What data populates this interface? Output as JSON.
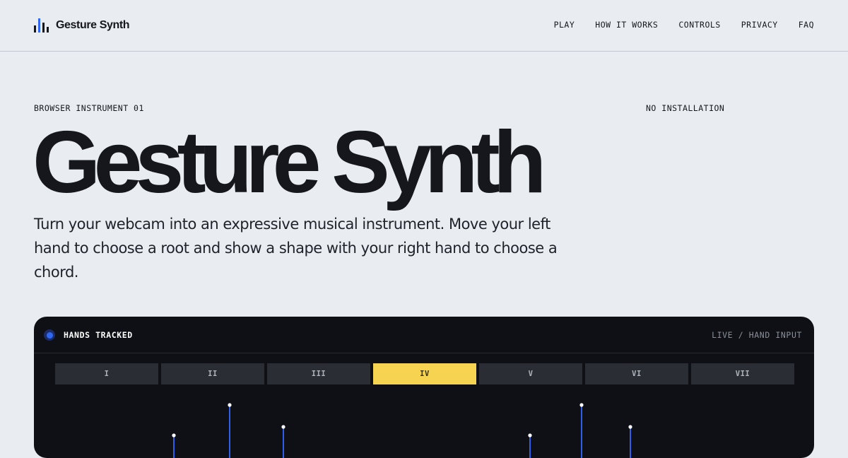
{
  "brand": {
    "name": "Gesture Synth",
    "icon": "bars-icon"
  },
  "nav": {
    "items": [
      "PLAY",
      "HOW IT WORKS",
      "CONTROLS",
      "PRIVACY",
      "FAQ"
    ]
  },
  "hero": {
    "eyebrow_left": "BROWSER INSTRUMENT 01",
    "eyebrow_right": "NO INSTALLATION",
    "title": "Gesture Synth",
    "lead": "Turn your webcam into an expressive musical instrument. Move your left hand to choose a root and show a shape with your right hand to choose a chord."
  },
  "panel": {
    "status": "HANDS TRACKED",
    "mode": "LIVE / HAND INPUT",
    "chords": [
      "I",
      "II",
      "III",
      "IV",
      "V",
      "VI",
      "VII"
    ],
    "active_chord": "IV"
  },
  "colors": {
    "background": "#e9edf2",
    "panel": "#0e1016",
    "accent_yellow": "#f6d350",
    "accent_blue": "#3168f2"
  }
}
